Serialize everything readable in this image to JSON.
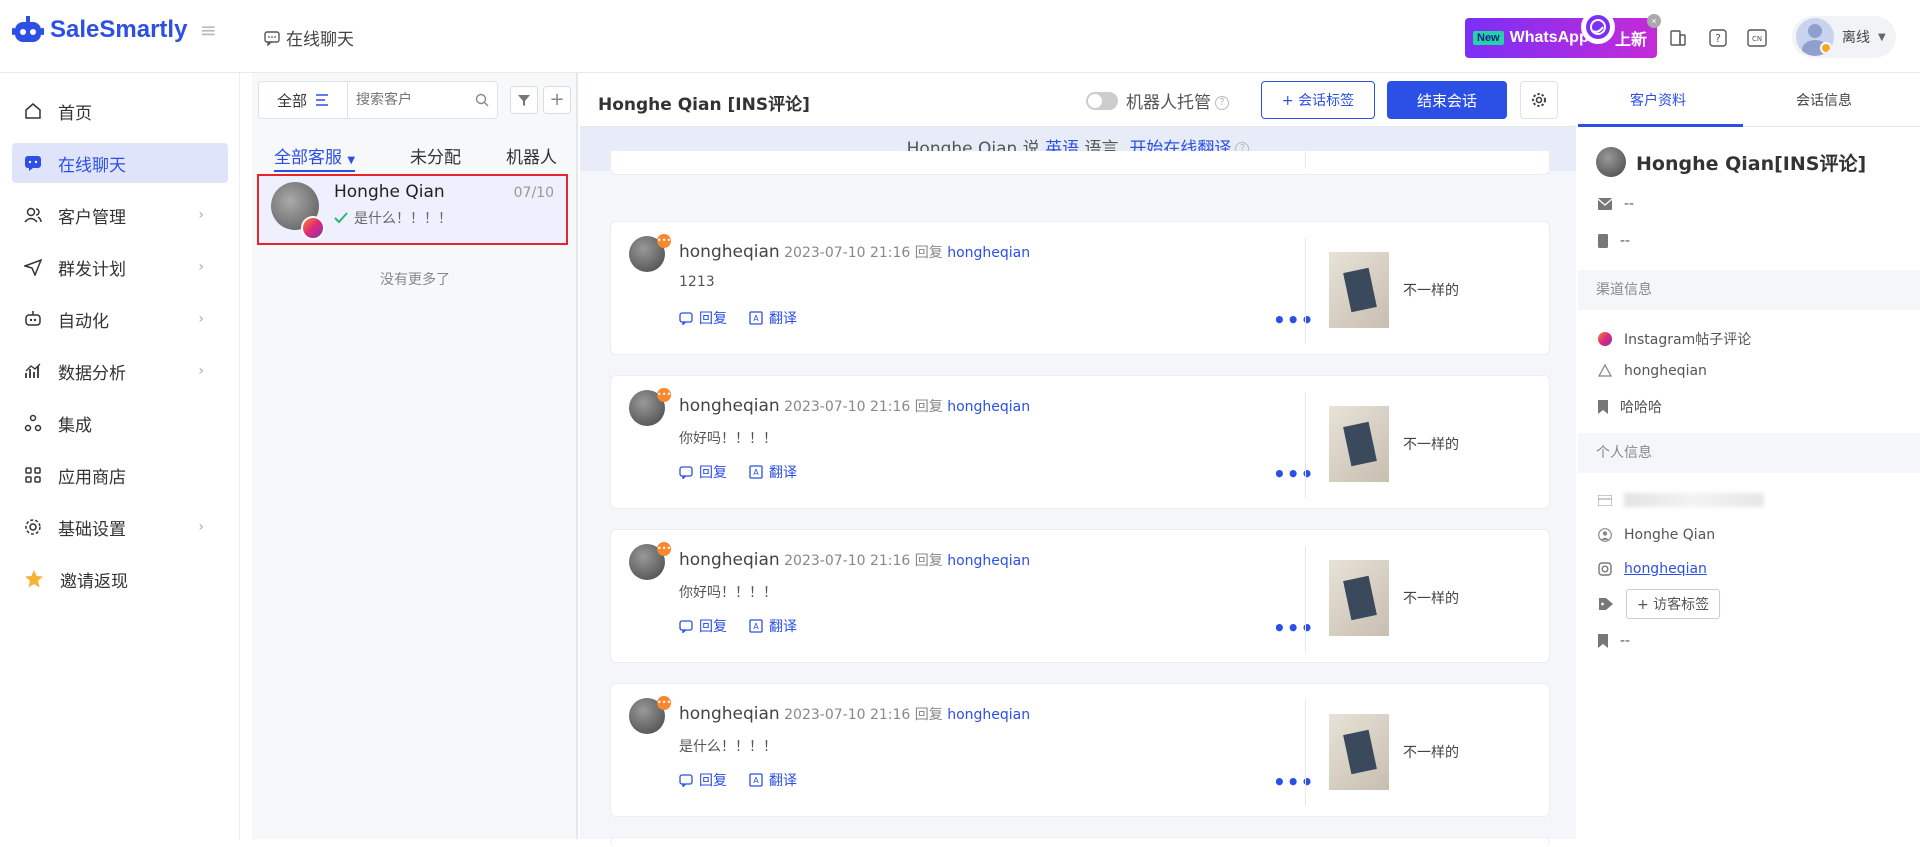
{
  "app": {
    "logo_text": "SaleSmartly",
    "page_tab": "在线聊天",
    "whatsapp_banner": {
      "new_badge": "New",
      "label": "WhatsApp",
      "suffix": "上新",
      "close": "×"
    },
    "topbar_icons": [
      "phone-icon",
      "help-icon",
      "language-icon"
    ],
    "language_code": "CN",
    "user_status": "离线"
  },
  "sidebar": {
    "items": [
      {
        "label": "首页",
        "icon": "home-icon"
      },
      {
        "label": "在线聊天",
        "icon": "chat-icon",
        "active": true
      },
      {
        "label": "客户管理",
        "icon": "users-icon"
      },
      {
        "label": "群发计划",
        "icon": "send-icon"
      },
      {
        "label": "自动化",
        "icon": "robot-icon"
      },
      {
        "label": "数据分析",
        "icon": "chart-icon"
      },
      {
        "label": "集成",
        "icon": "integration-icon"
      },
      {
        "label": "应用商店",
        "icon": "apps-icon"
      },
      {
        "label": "基础设置",
        "icon": "settings-icon"
      },
      {
        "label": "邀请返现",
        "icon": "star-icon"
      }
    ]
  },
  "conversation_list": {
    "all_button": "全部",
    "search_placeholder": "搜索客户",
    "filter_tabs": [
      "全部客服",
      "未分配",
      "机器人"
    ],
    "conversation": {
      "name": "Honghe Qian",
      "date": "07/10",
      "preview": "是什么！！！！"
    },
    "no_more": "没有更多了"
  },
  "chat": {
    "title": "Honghe Qian [INS评论]",
    "robot_label": "机器人托管",
    "tag_button": "+ 会话标签",
    "end_button": "结束会话",
    "translate": {
      "prefix": "Honghe Qian 说",
      "lang": "英语",
      "middle": "语言,",
      "link": "开始在线翻译"
    },
    "messages": [
      {
        "user": "hongheqian",
        "time": "2023-07-10 21:16",
        "reply_label": "回复",
        "reply_to": "hongheqian",
        "text": "1213",
        "post_text": "不一样的"
      },
      {
        "user": "hongheqian",
        "time": "2023-07-10 21:16",
        "reply_label": "回复",
        "reply_to": "hongheqian",
        "text": "你好吗！！！！",
        "post_text": "不一样的"
      },
      {
        "user": "hongheqian",
        "time": "2023-07-10 21:16",
        "reply_label": "回复",
        "reply_to": "hongheqian",
        "text": "你好吗！！！！",
        "post_text": "不一样的"
      },
      {
        "user": "hongheqian",
        "time": "2023-07-10 21:16",
        "reply_label": "回复",
        "reply_to": "hongheqian",
        "text": "是什么！！！！",
        "post_text": "不一样的"
      }
    ],
    "action_reply": "回复",
    "action_translate": "翻译"
  },
  "profile": {
    "tabs": [
      "客户资料",
      "会话信息"
    ],
    "name": "Honghe Qian[INS评论]",
    "email": "--",
    "phone": "--",
    "channel_section": "渠道信息",
    "channel": "Instagram帖子评论",
    "channel_account": "hongheqian",
    "channel_note": "哈哈哈",
    "personal_section": "个人信息",
    "display_name": "Honghe Qian",
    "ins_handle": "hongheqian",
    "visitor_tag_button": "+ 访客标签",
    "remark": "--"
  }
}
